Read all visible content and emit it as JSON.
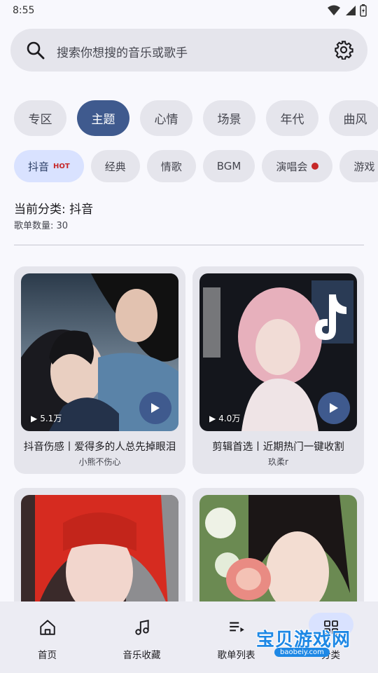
{
  "status": {
    "time": "8:55"
  },
  "search": {
    "placeholder": "搜索你想搜的音乐或歌手"
  },
  "categories": [
    "专区",
    "主题",
    "心情",
    "场景",
    "年代",
    "曲风"
  ],
  "active_category": "主题",
  "subcategories": [
    {
      "label": "抖音",
      "badge": "HOT"
    },
    {
      "label": "经典"
    },
    {
      "label": "情歌"
    },
    {
      "label": "BGM"
    },
    {
      "label": "演唱会",
      "dot": true
    },
    {
      "label": "游戏"
    }
  ],
  "current": {
    "label": "当前分类: 抖音",
    "count": "歌单数量: 30"
  },
  "playlists": [
    {
      "title": "抖音伤感丨爱得多的人总先掉眼泪",
      "author": "小熊不伤心",
      "plays": "5.1万"
    },
    {
      "title": "剪辑首选丨近期热门一键收割",
      "author": "玖柔r",
      "plays": "4.0万"
    },
    {
      "title": "",
      "author": "",
      "plays": ""
    },
    {
      "title": "",
      "author": "",
      "plays": ""
    }
  ],
  "nav": {
    "home": "首页",
    "favorites": "音乐收藏",
    "playlists": "歌单列表",
    "category": "分类"
  },
  "watermark": {
    "text": "宝贝游戏网",
    "url": "baobeiy.com"
  },
  "colors": {
    "accent": "#3f5a8e",
    "active_chip": "#d9e2ff",
    "chip": "#e5e5ec",
    "hot": "#c62828"
  }
}
